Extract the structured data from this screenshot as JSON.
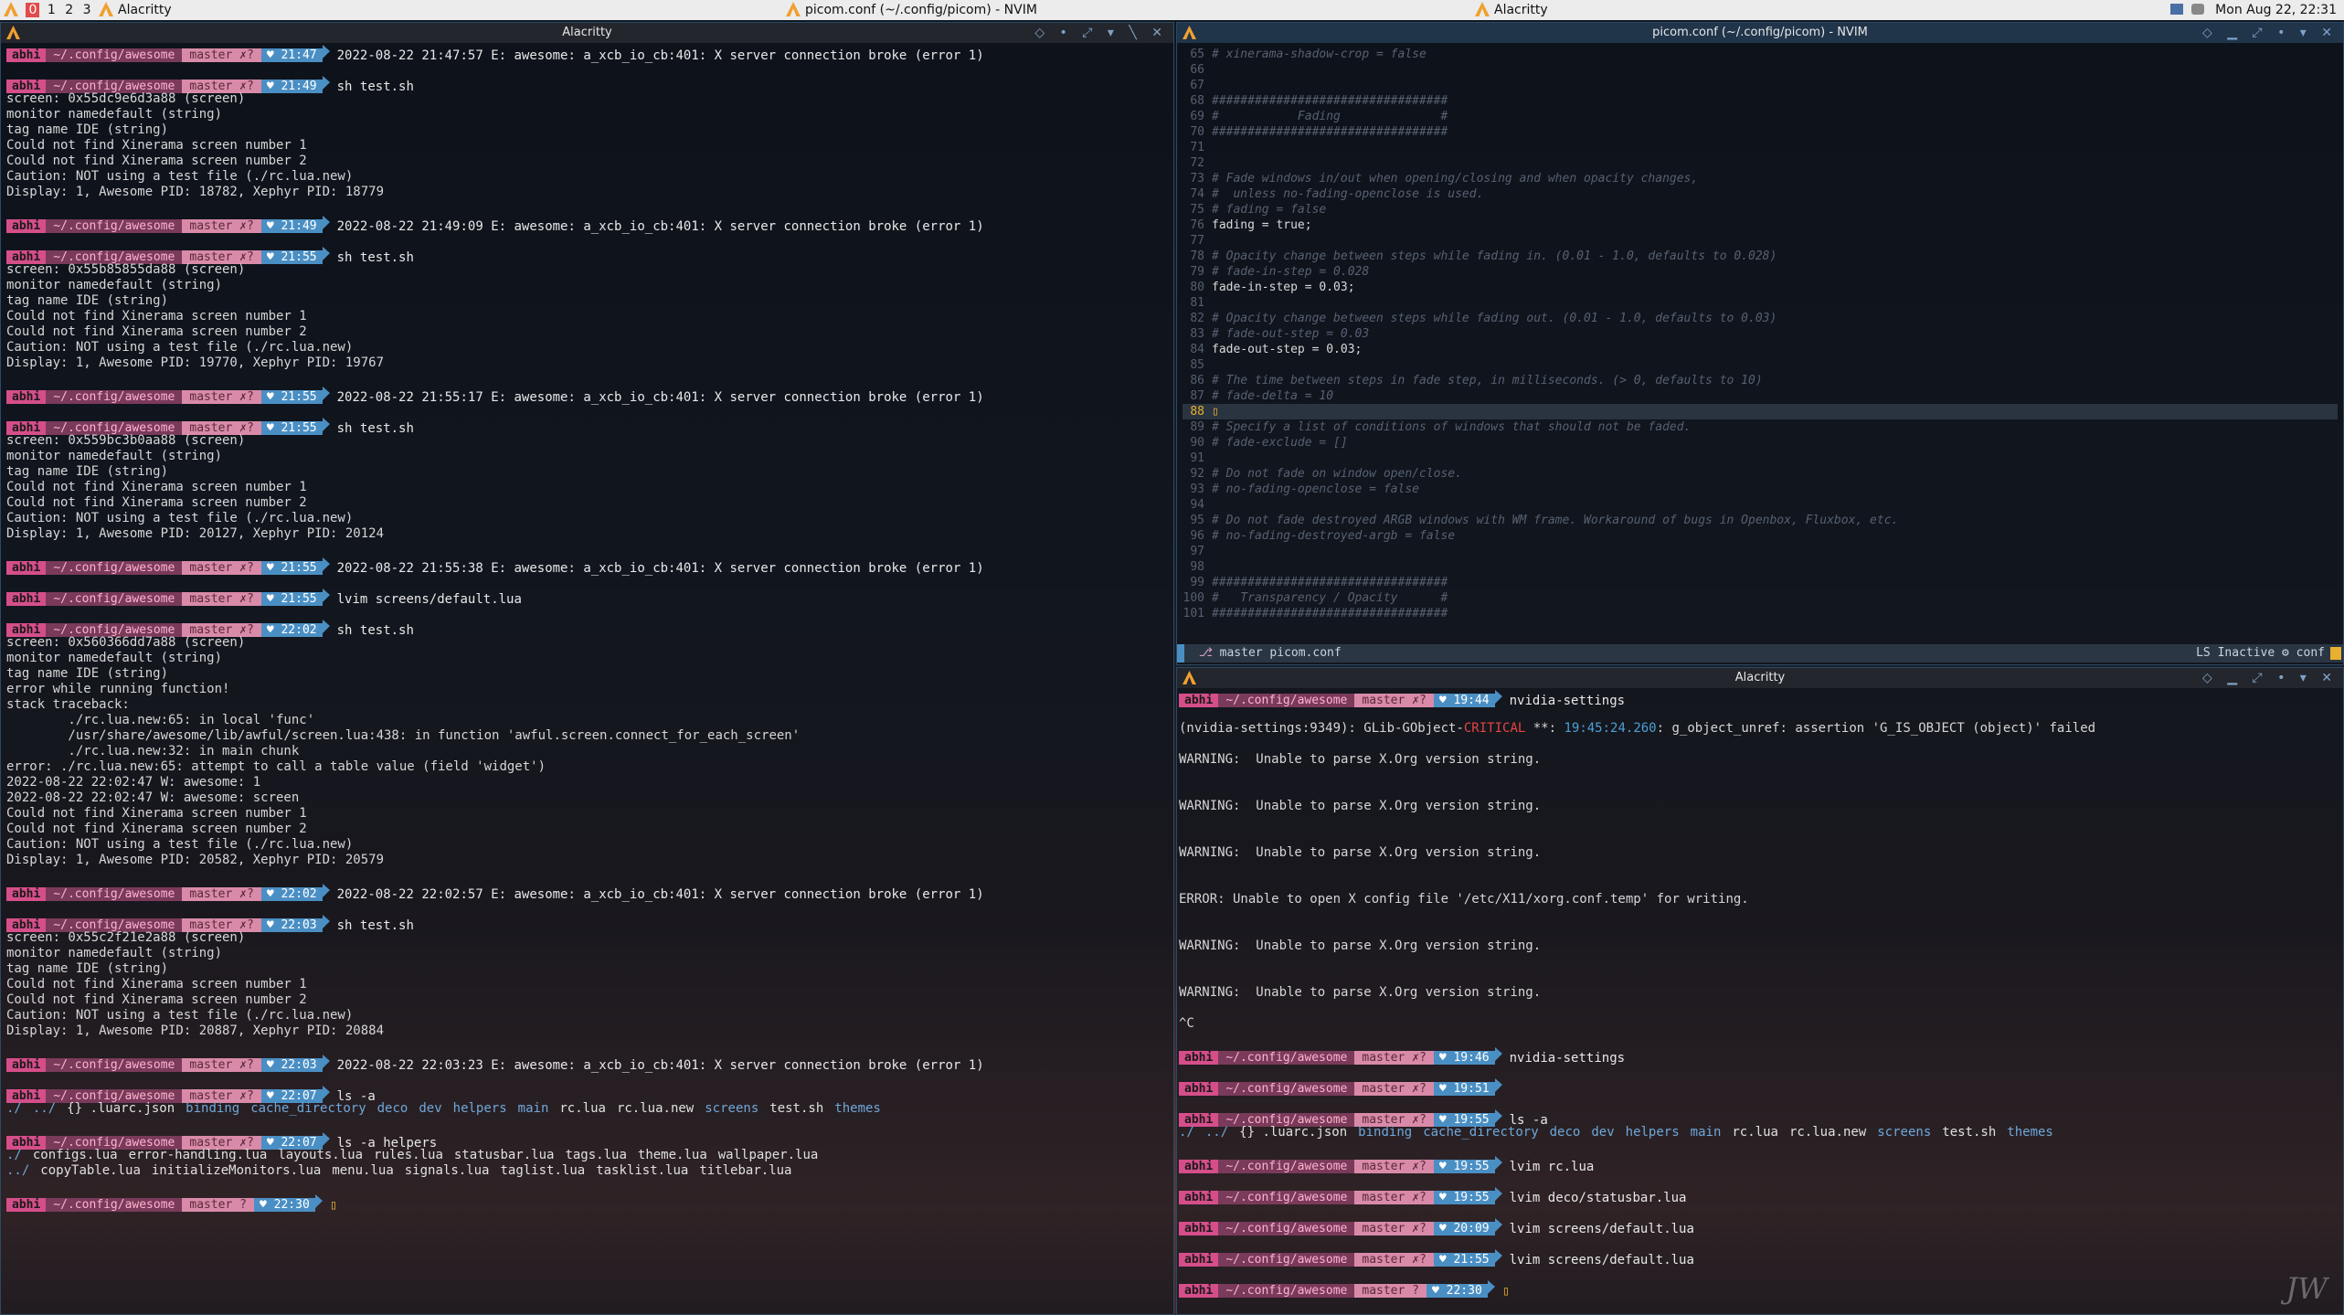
{
  "topbar": {
    "tags": [
      "0",
      "1",
      "2",
      "3"
    ],
    "left_app": "Alacritty",
    "center_title": "picom.conf (~/.config/picom) - NVIM",
    "right_app": "Alacritty",
    "clock": "Mon Aug 22, 22:31"
  },
  "prompt": {
    "user": "abhi",
    "dir": "~/.config/awesome",
    "git_dirty": "master ✗?",
    "git_clean": "master ?"
  },
  "left_terminal": {
    "title": "Alacritty",
    "lines": [
      {
        "type": "prompt",
        "time": "21:47",
        "cmd": "2022-08-22 21:47:57 E: awesome: a_xcb_io_cb:401: X server connection broke (error 1)"
      },
      {
        "type": "gap"
      },
      {
        "type": "prompt",
        "time": "21:49",
        "cmd": "sh test.sh"
      },
      {
        "type": "text",
        "text": "screen: 0x55dc9e6d3a88 (screen)"
      },
      {
        "type": "text",
        "text": "monitor namedefault (string)"
      },
      {
        "type": "text",
        "text": "tag name IDE (string)"
      },
      {
        "type": "text",
        "text": "Could not find Xinerama screen number 1"
      },
      {
        "type": "text",
        "text": "Could not find Xinerama screen number 2"
      },
      {
        "type": "text",
        "text": "Caution: NOT using a test file (./rc.lua.new)"
      },
      {
        "type": "text",
        "text": "Display: 1, Awesome PID: 18782, Xephyr PID: 18779"
      },
      {
        "type": "gap"
      },
      {
        "type": "prompt",
        "time": "21:49",
        "cmd": "2022-08-22 21:49:09 E: awesome: a_xcb_io_cb:401: X server connection broke (error 1)"
      },
      {
        "type": "gap"
      },
      {
        "type": "prompt",
        "time": "21:55",
        "cmd": "sh test.sh"
      },
      {
        "type": "text",
        "text": "screen: 0x55b85855da88 (screen)"
      },
      {
        "type": "text",
        "text": "monitor namedefault (string)"
      },
      {
        "type": "text",
        "text": "tag name IDE (string)"
      },
      {
        "type": "text",
        "text": "Could not find Xinerama screen number 1"
      },
      {
        "type": "text",
        "text": "Could not find Xinerama screen number 2"
      },
      {
        "type": "text",
        "text": "Caution: NOT using a test file (./rc.lua.new)"
      },
      {
        "type": "text",
        "text": "Display: 1, Awesome PID: 19770, Xephyr PID: 19767"
      },
      {
        "type": "gap"
      },
      {
        "type": "prompt",
        "time": "21:55",
        "cmd": "2022-08-22 21:55:17 E: awesome: a_xcb_io_cb:401: X server connection broke (error 1)"
      },
      {
        "type": "gap"
      },
      {
        "type": "prompt",
        "time": "21:55",
        "cmd": "sh test.sh"
      },
      {
        "type": "text",
        "text": "screen: 0x559bc3b0aa88 (screen)"
      },
      {
        "type": "text",
        "text": "monitor namedefault (string)"
      },
      {
        "type": "text",
        "text": "tag name IDE (string)"
      },
      {
        "type": "text",
        "text": "Could not find Xinerama screen number 1"
      },
      {
        "type": "text",
        "text": "Could not find Xinerama screen number 2"
      },
      {
        "type": "text",
        "text": "Caution: NOT using a test file (./rc.lua.new)"
      },
      {
        "type": "text",
        "text": "Display: 1, Awesome PID: 20127, Xephyr PID: 20124"
      },
      {
        "type": "gap"
      },
      {
        "type": "prompt",
        "time": "21:55",
        "cmd": "2022-08-22 21:55:38 E: awesome: a_xcb_io_cb:401: X server connection broke (error 1)"
      },
      {
        "type": "gap"
      },
      {
        "type": "prompt",
        "time": "21:55",
        "cmd": "lvim screens/default.lua"
      },
      {
        "type": "gap"
      },
      {
        "type": "prompt",
        "time": "22:02",
        "cmd": "sh test.sh"
      },
      {
        "type": "text",
        "text": "screen: 0x560366dd7a88 (screen)"
      },
      {
        "type": "text",
        "text": "monitor namedefault (string)"
      },
      {
        "type": "text",
        "text": "tag name IDE (string)"
      },
      {
        "type": "text",
        "text": "error while running function!"
      },
      {
        "type": "text",
        "text": "stack traceback:"
      },
      {
        "type": "text",
        "text": "        ./rc.lua.new:65: in local 'func'"
      },
      {
        "type": "text",
        "text": "        /usr/share/awesome/lib/awful/screen.lua:438: in function 'awful.screen.connect_for_each_screen'"
      },
      {
        "type": "text",
        "text": "        ./rc.lua.new:32: in main chunk"
      },
      {
        "type": "text",
        "text": "error: ./rc.lua.new:65: attempt to call a table value (field 'widget')"
      },
      {
        "type": "text",
        "text": "2022-08-22 22:02:47 W: awesome: 1"
      },
      {
        "type": "text",
        "text": "2022-08-22 22:02:47 W: awesome: screen"
      },
      {
        "type": "text",
        "text": "Could not find Xinerama screen number 1"
      },
      {
        "type": "text",
        "text": "Could not find Xinerama screen number 2"
      },
      {
        "type": "text",
        "text": "Caution: NOT using a test file (./rc.lua.new)"
      },
      {
        "type": "text",
        "text": "Display: 1, Awesome PID: 20582, Xephyr PID: 20579"
      },
      {
        "type": "gap"
      },
      {
        "type": "prompt",
        "time": "22:02",
        "cmd": "2022-08-22 22:02:57 E: awesome: a_xcb_io_cb:401: X server connection broke (error 1)"
      },
      {
        "type": "gap"
      },
      {
        "type": "prompt",
        "time": "22:03",
        "cmd": "sh test.sh"
      },
      {
        "type": "text",
        "text": "screen: 0x55c2f21e2a88 (screen)"
      },
      {
        "type": "text",
        "text": "monitor namedefault (string)"
      },
      {
        "type": "text",
        "text": "tag name IDE (string)"
      },
      {
        "type": "text",
        "text": "Could not find Xinerama screen number 1"
      },
      {
        "type": "text",
        "text": "Could not find Xinerama screen number 2"
      },
      {
        "type": "text",
        "text": "Caution: NOT using a test file (./rc.lua.new)"
      },
      {
        "type": "text",
        "text": "Display: 1, Awesome PID: 20887, Xephyr PID: 20884"
      },
      {
        "type": "gap"
      },
      {
        "type": "prompt",
        "time": "22:03",
        "cmd": "2022-08-22 22:03:23 E: awesome: a_xcb_io_cb:401: X server connection broke (error 1)"
      },
      {
        "type": "gap"
      },
      {
        "type": "prompt",
        "time": "22:07",
        "cmd": "ls -a"
      },
      {
        "type": "ls",
        "entries": [
          [
            "./",
            "dir"
          ],
          [
            "../",
            "dir"
          ],
          [
            "{} .luarc.json",
            "file"
          ],
          [
            "binding",
            "dir"
          ],
          [
            "cache_directory",
            "dir"
          ],
          [
            "deco",
            "dir"
          ],
          [
            "dev",
            "dir"
          ],
          [
            "helpers",
            "dir"
          ],
          [
            "main",
            "dir"
          ],
          [
            "rc.lua",
            "file"
          ],
          [
            "rc.lua.new",
            "file"
          ],
          [
            "screens",
            "dir"
          ],
          [
            "test.sh",
            "file"
          ],
          [
            "themes",
            "dir"
          ]
        ]
      },
      {
        "type": "gap"
      },
      {
        "type": "prompt",
        "time": "22:07",
        "cmd": "ls -a helpers"
      },
      {
        "type": "ls",
        "entries": [
          [
            "./",
            "dir"
          ],
          [
            "configs.lua",
            "file"
          ],
          [
            "error-handling.lua",
            "file"
          ],
          [
            "layouts.lua",
            "file"
          ],
          [
            "rules.lua",
            "file"
          ],
          [
            "statusbar.lua",
            "file"
          ],
          [
            "tags.lua",
            "file"
          ],
          [
            "theme.lua",
            "file"
          ],
          [
            "wallpaper.lua",
            "file"
          ]
        ]
      },
      {
        "type": "ls",
        "entries": [
          [
            "../",
            "dir"
          ],
          [
            "copyTable.lua",
            "file"
          ],
          [
            "initializeMonitors.lua",
            "file"
          ],
          [
            "menu.lua",
            "file"
          ],
          [
            "signals.lua",
            "file"
          ],
          [
            "taglist.lua",
            "file"
          ],
          [
            "tasklist.lua",
            "file"
          ],
          [
            "titlebar.lua",
            "file"
          ]
        ]
      },
      {
        "type": "gap"
      },
      {
        "type": "prompt",
        "time": "22:30",
        "cmd": "",
        "clean": true
      }
    ]
  },
  "nvim": {
    "title": "picom.conf (~/.config/picom) - NVIM",
    "lines": [
      {
        "n": "65",
        "t": "# xinerama-shadow-crop = false",
        "c": true
      },
      {
        "n": "66",
        "t": "",
        "c": false
      },
      {
        "n": "67",
        "t": "",
        "c": false
      },
      {
        "n": "68",
        "t": "#################################",
        "c": true
      },
      {
        "n": "69",
        "t": "#           Fading              #",
        "c": true
      },
      {
        "n": "70",
        "t": "#################################",
        "c": true
      },
      {
        "n": "71",
        "t": "",
        "c": false
      },
      {
        "n": "72",
        "t": "",
        "c": false
      },
      {
        "n": "73",
        "t": "# Fade windows in/out when opening/closing and when opacity changes,",
        "c": true
      },
      {
        "n": "74",
        "t": "#  unless no-fading-openclose is used.",
        "c": true
      },
      {
        "n": "75",
        "t": "# fading = false",
        "c": true
      },
      {
        "n": "76",
        "t": "fading = true;",
        "c": false
      },
      {
        "n": "77",
        "t": "",
        "c": false
      },
      {
        "n": "78",
        "t": "# Opacity change between steps while fading in. (0.01 - 1.0, defaults to 0.028)",
        "c": true
      },
      {
        "n": "79",
        "t": "# fade-in-step = 0.028",
        "c": true
      },
      {
        "n": "80",
        "t": "fade-in-step = 0.03;",
        "c": false
      },
      {
        "n": "81",
        "t": "",
        "c": false
      },
      {
        "n": "82",
        "t": "# Opacity change between steps while fading out. (0.01 - 1.0, defaults to 0.03)",
        "c": true
      },
      {
        "n": "83",
        "t": "# fade-out-step = 0.03",
        "c": true
      },
      {
        "n": "84",
        "t": "fade-out-step = 0.03;",
        "c": false
      },
      {
        "n": "85",
        "t": "",
        "c": false
      },
      {
        "n": "86",
        "t": "# The time between steps in fade step, in milliseconds. (> 0, defaults to 10)",
        "c": true
      },
      {
        "n": "87",
        "t": "# fade-delta = 10",
        "c": true
      },
      {
        "n": "88",
        "t": "▯",
        "c": false,
        "cur": true
      },
      {
        "n": "89",
        "t": "# Specify a list of conditions of windows that should not be faded.",
        "c": true
      },
      {
        "n": "90",
        "t": "# fade-exclude = []",
        "c": true
      },
      {
        "n": "91",
        "t": "",
        "c": false
      },
      {
        "n": "92",
        "t": "# Do not fade on window open/close.",
        "c": true
      },
      {
        "n": "93",
        "t": "# no-fading-openclose = false",
        "c": true
      },
      {
        "n": "94",
        "t": "",
        "c": false
      },
      {
        "n": "95",
        "t": "# Do not fade destroyed ARGB windows with WM frame. Workaround of bugs in Openbox, Fluxbox, etc.",
        "c": true
      },
      {
        "n": "96",
        "t": "# no-fading-destroyed-argb = false",
        "c": true
      },
      {
        "n": "97",
        "t": "",
        "c": false
      },
      {
        "n": "98",
        "t": "",
        "c": false
      },
      {
        "n": "99",
        "t": "#################################",
        "c": true
      },
      {
        "n": "100",
        "t": "#   Transparency / Opacity      #",
        "c": true
      },
      {
        "n": "101",
        "t": "#################################",
        "c": true
      }
    ],
    "status_left": "master  picom.conf",
    "status_right": "LS Inactive  ⚙ conf"
  },
  "right_terminal": {
    "title": "Alacritty",
    "lines": [
      {
        "type": "prompt",
        "time": "19:44",
        "cmd": "nvidia-settings"
      },
      {
        "type": "gap"
      },
      {
        "type": "glib",
        "pre": "(nvidia-settings:9349): GLib-GObject-",
        "crit": "CRITICAL",
        "mid": " **: ",
        "ts": "19:45:24.260",
        "post": ": g_object_unref: assertion 'G_IS_OBJECT (object)' failed"
      },
      {
        "type": "gap"
      },
      {
        "type": "text",
        "text": "WARNING:  Unable to parse X.Org version string."
      },
      {
        "type": "gap"
      },
      {
        "type": "gap"
      },
      {
        "type": "text",
        "text": "WARNING:  Unable to parse X.Org version string."
      },
      {
        "type": "gap"
      },
      {
        "type": "gap"
      },
      {
        "type": "text",
        "text": "WARNING:  Unable to parse X.Org version string."
      },
      {
        "type": "gap"
      },
      {
        "type": "gap"
      },
      {
        "type": "text",
        "text": "ERROR: Unable to open X config file '/etc/X11/xorg.conf.temp' for writing."
      },
      {
        "type": "gap"
      },
      {
        "type": "gap"
      },
      {
        "type": "text",
        "text": "WARNING:  Unable to parse X.Org version string."
      },
      {
        "type": "gap"
      },
      {
        "type": "gap"
      },
      {
        "type": "text",
        "text": "WARNING:  Unable to parse X.Org version string."
      },
      {
        "type": "gap"
      },
      {
        "type": "text",
        "text": "^C"
      },
      {
        "type": "gap"
      },
      {
        "type": "prompt",
        "time": "19:46",
        "cmd": "nvidia-settings"
      },
      {
        "type": "gap"
      },
      {
        "type": "prompt",
        "time": "19:51",
        "cmd": ""
      },
      {
        "type": "gap"
      },
      {
        "type": "prompt",
        "time": "19:55",
        "cmd": "ls -a"
      },
      {
        "type": "ls",
        "entries": [
          [
            "./",
            "dir"
          ],
          [
            "../",
            "dir"
          ],
          [
            "{} .luarc.json",
            "file"
          ],
          [
            "binding",
            "dir"
          ],
          [
            "cache_directory",
            "dir"
          ],
          [
            "deco",
            "dir"
          ],
          [
            "dev",
            "dir"
          ],
          [
            "helpers",
            "dir"
          ],
          [
            "main",
            "dir"
          ],
          [
            "rc.lua",
            "file"
          ],
          [
            "rc.lua.new",
            "file"
          ],
          [
            "screens",
            "dir"
          ],
          [
            "test.sh",
            "file"
          ],
          [
            "themes",
            "dir"
          ]
        ]
      },
      {
        "type": "gap"
      },
      {
        "type": "prompt",
        "time": "19:55",
        "cmd": "lvim rc.lua"
      },
      {
        "type": "gap"
      },
      {
        "type": "prompt",
        "time": "19:55",
        "cmd": "lvim deco/statusbar.lua"
      },
      {
        "type": "gap"
      },
      {
        "type": "prompt",
        "time": "20:09",
        "cmd": "lvim screens/default.lua"
      },
      {
        "type": "gap"
      },
      {
        "type": "prompt",
        "time": "21:55",
        "cmd": "lvim screens/default.lua"
      },
      {
        "type": "gap"
      },
      {
        "type": "prompt",
        "time": "22:30",
        "cmd": "",
        "clean": true
      }
    ]
  },
  "watermark": "JW"
}
